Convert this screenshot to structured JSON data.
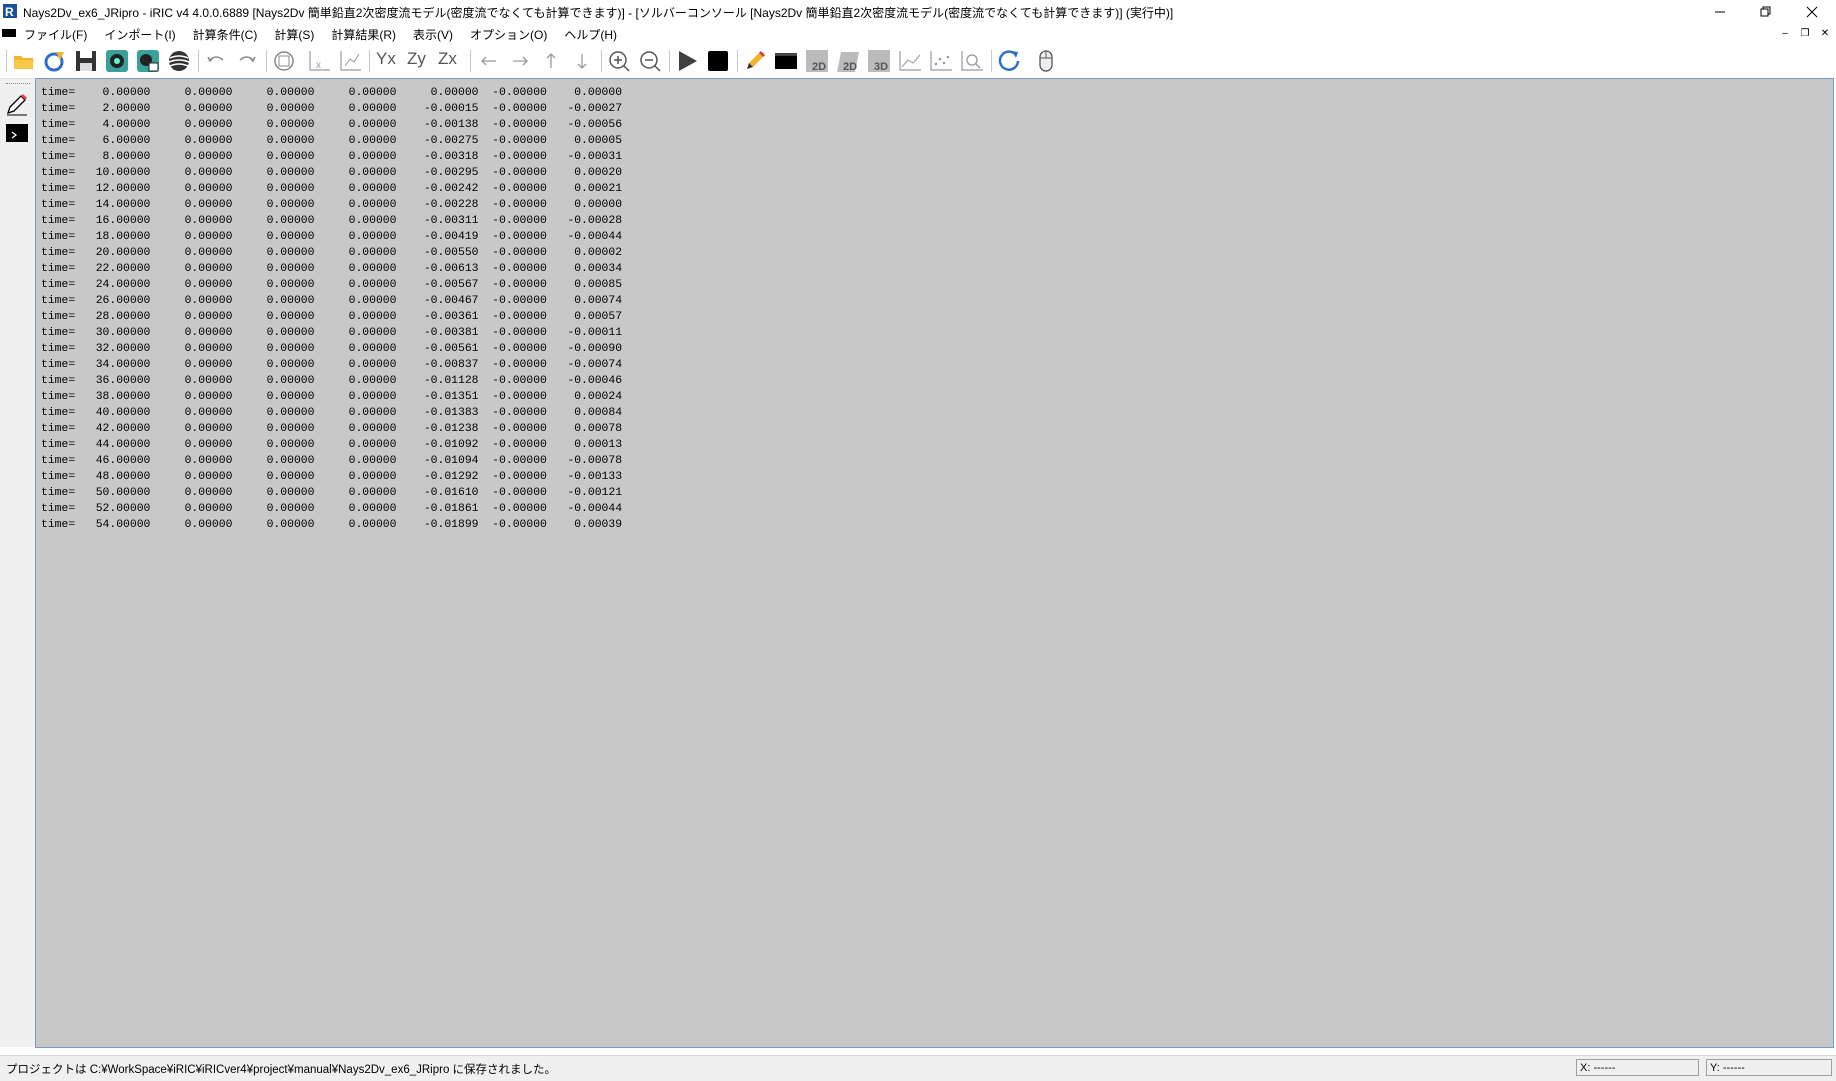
{
  "window": {
    "title": "Nays2Dv_ex6_JRipro - iRIC v4 4.0.0.6889 [Nays2Dv 簡単鉛直2次密度流モデル(密度流でなくても計算できます)] - [ソルバーコンソール [Nays2Dv 簡単鉛直2次密度流モデル(密度流でなくても計算できます)] (実行中)]",
    "minimize": "─",
    "restore": "❐",
    "close": "✕"
  },
  "menu": {
    "items": [
      {
        "label": "ファイル(F)"
      },
      {
        "label": "インポート(I)"
      },
      {
        "label": "計算条件(C)"
      },
      {
        "label": "計算(S)"
      },
      {
        "label": "計算結果(R)"
      },
      {
        "label": "表示(V)"
      },
      {
        "label": "オプション(O)"
      },
      {
        "label": "ヘルプ(H)"
      }
    ],
    "mdi_minimize": "–",
    "mdi_restore": "❐",
    "mdi_close": "✕"
  },
  "toolbar": {
    "icons": [
      "open-folder-icon",
      "import-icon",
      "save-icon",
      "snapshot-icon",
      "snapshot-window-icon",
      "globe-icon",
      "undo-icon",
      "redo-icon",
      "fit-icon",
      "x-axis-icon",
      "xy-axis-icon",
      "yx-axis-icon",
      "zy-axis-icon",
      "zx-axis-icon",
      "arrow-left-icon",
      "arrow-right-icon",
      "arrow-up-icon",
      "arrow-down-icon",
      "zoom-in-icon",
      "zoom-out-icon",
      "run-icon",
      "stop-icon",
      "pencil-icon",
      "console-icon",
      "2d-view-icon",
      "2d-bird-view-icon",
      "3d-view-icon",
      "graph-icon",
      "scatter-icon",
      "graph-zoom-icon",
      "refresh-icon",
      "mouse-icon"
    ],
    "labels": {
      "yx": "Yx",
      "zy": "Zy",
      "zx": "Zx",
      "two_d": "2D",
      "two_d_bird": "2D",
      "three_d": "3D"
    },
    "colors": {
      "run": "#404040",
      "stop": "#000000",
      "folder": "#f2b32e",
      "teal": "#3aa09a",
      "refresh": "#2f6fc8"
    }
  },
  "console": {
    "prefix": "time=",
    "rows": [
      [
        "0.00000",
        "0.00000",
        "0.00000",
        "0.00000",
        "0.00000",
        "-0.00000",
        "0.00000"
      ],
      [
        "2.00000",
        "0.00000",
        "0.00000",
        "0.00000",
        "-0.00015",
        "-0.00000",
        "-0.00027"
      ],
      [
        "4.00000",
        "0.00000",
        "0.00000",
        "0.00000",
        "-0.00138",
        "-0.00000",
        "-0.00056"
      ],
      [
        "6.00000",
        "0.00000",
        "0.00000",
        "0.00000",
        "-0.00275",
        "-0.00000",
        "0.00005"
      ],
      [
        "8.00000",
        "0.00000",
        "0.00000",
        "0.00000",
        "-0.00318",
        "-0.00000",
        "-0.00031"
      ],
      [
        "10.00000",
        "0.00000",
        "0.00000",
        "0.00000",
        "-0.00295",
        "-0.00000",
        "0.00020"
      ],
      [
        "12.00000",
        "0.00000",
        "0.00000",
        "0.00000",
        "-0.00242",
        "-0.00000",
        "0.00021"
      ],
      [
        "14.00000",
        "0.00000",
        "0.00000",
        "0.00000",
        "-0.00228",
        "-0.00000",
        "0.00000"
      ],
      [
        "16.00000",
        "0.00000",
        "0.00000",
        "0.00000",
        "-0.00311",
        "-0.00000",
        "-0.00028"
      ],
      [
        "18.00000",
        "0.00000",
        "0.00000",
        "0.00000",
        "-0.00419",
        "-0.00000",
        "-0.00044"
      ],
      [
        "20.00000",
        "0.00000",
        "0.00000",
        "0.00000",
        "-0.00550",
        "-0.00000",
        "0.00002"
      ],
      [
        "22.00000",
        "0.00000",
        "0.00000",
        "0.00000",
        "-0.00613",
        "-0.00000",
        "0.00034"
      ],
      [
        "24.00000",
        "0.00000",
        "0.00000",
        "0.00000",
        "-0.00567",
        "-0.00000",
        "0.00085"
      ],
      [
        "26.00000",
        "0.00000",
        "0.00000",
        "0.00000",
        "-0.00467",
        "-0.00000",
        "0.00074"
      ],
      [
        "28.00000",
        "0.00000",
        "0.00000",
        "0.00000",
        "-0.00361",
        "-0.00000",
        "0.00057"
      ],
      [
        "30.00000",
        "0.00000",
        "0.00000",
        "0.00000",
        "-0.00381",
        "-0.00000",
        "-0.00011"
      ],
      [
        "32.00000",
        "0.00000",
        "0.00000",
        "0.00000",
        "-0.00561",
        "-0.00000",
        "-0.00090"
      ],
      [
        "34.00000",
        "0.00000",
        "0.00000",
        "0.00000",
        "-0.00837",
        "-0.00000",
        "-0.00074"
      ],
      [
        "36.00000",
        "0.00000",
        "0.00000",
        "0.00000",
        "-0.01128",
        "-0.00000",
        "-0.00046"
      ],
      [
        "38.00000",
        "0.00000",
        "0.00000",
        "0.00000",
        "-0.01351",
        "-0.00000",
        "0.00024"
      ],
      [
        "40.00000",
        "0.00000",
        "0.00000",
        "0.00000",
        "-0.01383",
        "-0.00000",
        "0.00084"
      ],
      [
        "42.00000",
        "0.00000",
        "0.00000",
        "0.00000",
        "-0.01238",
        "-0.00000",
        "0.00078"
      ],
      [
        "44.00000",
        "0.00000",
        "0.00000",
        "0.00000",
        "-0.01092",
        "-0.00000",
        "0.00013"
      ],
      [
        "46.00000",
        "0.00000",
        "0.00000",
        "0.00000",
        "-0.01094",
        "-0.00000",
        "-0.00078"
      ],
      [
        "48.00000",
        "0.00000",
        "0.00000",
        "0.00000",
        "-0.01292",
        "-0.00000",
        "-0.00133"
      ],
      [
        "50.00000",
        "0.00000",
        "0.00000",
        "0.00000",
        "-0.01610",
        "-0.00000",
        "-0.00121"
      ],
      [
        "52.00000",
        "0.00000",
        "0.00000",
        "0.00000",
        "-0.01861",
        "-0.00000",
        "-0.00044"
      ],
      [
        "54.00000",
        "0.00000",
        "0.00000",
        "0.00000",
        "-0.01899",
        "-0.00000",
        "0.00039"
      ]
    ]
  },
  "sidebar": {
    "icons": [
      "edit-pencil-icon",
      "console-window-icon"
    ]
  },
  "status": {
    "message": "プロジェクトは C:¥WorkSpace¥iRIC¥iRICver4¥project¥manual¥Nays2Dv_ex6_JRipro に保存されました。",
    "x_label": "X: ------",
    "y_label": "Y: ------"
  }
}
